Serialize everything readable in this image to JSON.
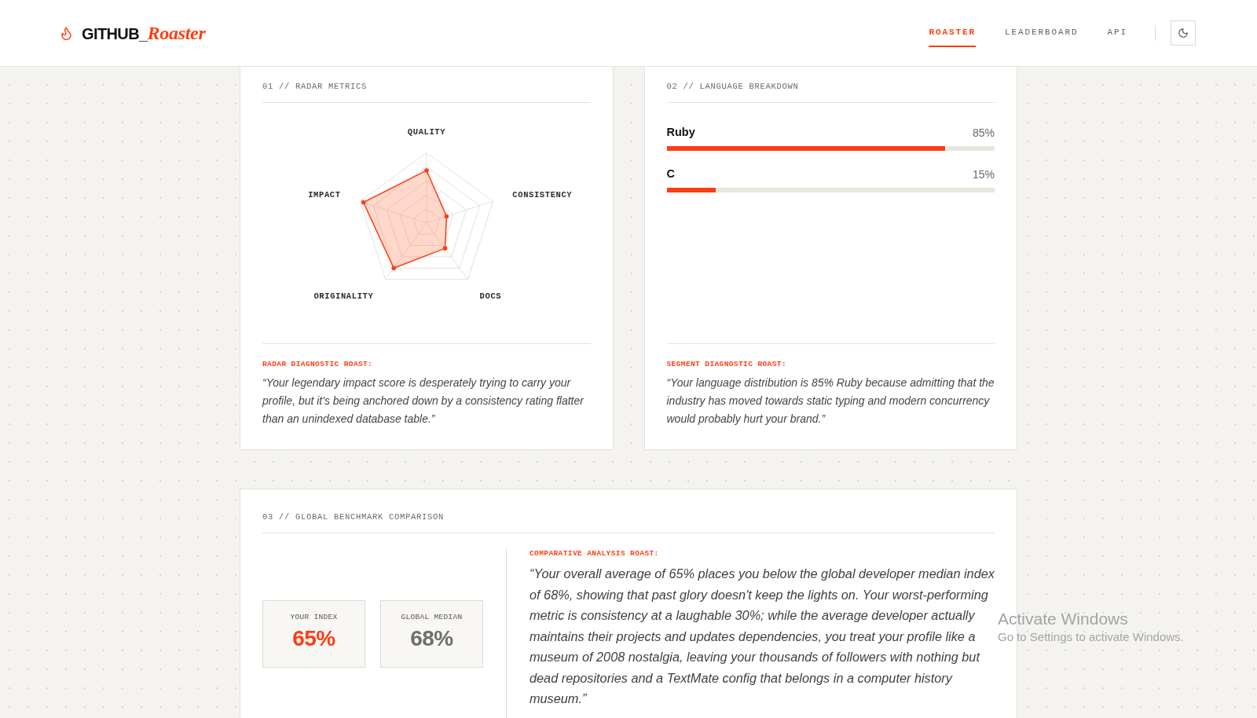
{
  "header": {
    "logo": {
      "primary": "GITHUB_",
      "accent": "Roaster"
    },
    "nav": [
      {
        "label": "ROASTER",
        "selected": true
      },
      {
        "label": "LEADERBOARD",
        "selected": false
      },
      {
        "label": "API",
        "selected": false
      }
    ]
  },
  "radar_card": {
    "title": "01 // RADAR METRICS",
    "axes": [
      "QUALITY",
      "CONSISTENCY",
      "DOCS",
      "ORIGINALITY",
      "IMPACT"
    ],
    "roast_label": "RADAR DIAGNOSTIC ROAST:",
    "roast": "“Your legendary impact score is desperately trying to carry your profile, but it's being anchored down by a consistency rating flatter than an unindexed database table.”"
  },
  "language_card": {
    "title": "02 // LANGUAGE BREAKDOWN",
    "languages": [
      {
        "name": "Ruby",
        "percent": "85%",
        "level": 0.85
      },
      {
        "name": "C",
        "percent": "15%",
        "level": 0.15
      }
    ],
    "roast_label": "SEGMENT DIAGNOSTIC ROAST:",
    "roast": "“Your language distribution is 85% Ruby because admitting that the industry has moved towards static typing and modern concurrency would probably hurt your brand.”"
  },
  "benchmark_card": {
    "title": "03 // GLOBAL BENCHMARK COMPARISON",
    "stats": [
      {
        "label": "YOUR INDEX",
        "value": "65%",
        "kind": "user"
      },
      {
        "label": "GLOBAL MEDIAN",
        "value": "68%",
        "kind": "median"
      }
    ],
    "roast_label": "COMPARATIVE ANALYSIS ROAST:",
    "roast": "“Your overall average of 65% places you below the global developer median index of 68%, showing that past glory doesn't keep the lights on. Your worst-performing metric is consistency at a laughable 30%; while the average developer actually maintains their projects and updates dependencies, you treat your profile like a museum of 2008 nostalgia, leaving your thousands of followers with nothing but dead repositories and a TextMate config that belongs in a computer history museum.”"
  },
  "os_notice": {
    "title": "Activate Windows",
    "message": "Go to Settings to activate Windows."
  }
}
